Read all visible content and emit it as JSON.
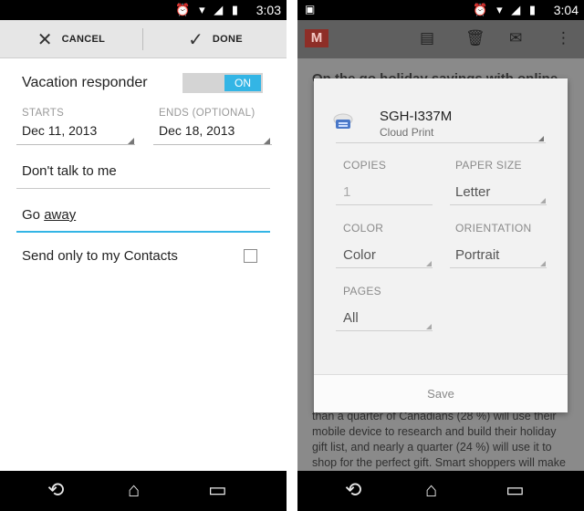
{
  "left": {
    "status": {
      "time": "3:03",
      "icons": "⏰ ▾ ◢ ▮"
    },
    "actionbar": {
      "cancel_label": "CANCEL",
      "done_label": "DONE",
      "cancel_glyph": "✕",
      "done_glyph": "✓"
    },
    "vacation": {
      "label": "Vacation responder",
      "toggle_value": "ON"
    },
    "starts": {
      "caption": "STARTS",
      "value": "Dec 11, 2013"
    },
    "ends": {
      "caption": "ENDS (OPTIONAL)",
      "value": "Dec 18, 2013"
    },
    "subject": "Don't talk to me",
    "message": {
      "prefix": "Go ",
      "underlined": "away"
    },
    "contacts_only": {
      "label": "Send only to my Contacts",
      "checked": false
    },
    "accent": "#33b5e5"
  },
  "right": {
    "status": {
      "time": "3:04",
      "icons": "⏰ ▾ ◢ ▮",
      "notification_icon": "▣"
    },
    "gmail": {
      "logo": "M"
    },
    "background_headline": "On the go holiday savings with online",
    "background_text": "than a quarter of Canadians (28 %) will use their mobile device to research and build their holiday gift list, and nearly a quarter (24 %) will use it to shop for the perfect gift. Smart shoppers will make",
    "print_dialog": {
      "printer_name": "SGH-I337M",
      "printer_sub": "Cloud Print",
      "copies": {
        "caption": "COPIES",
        "value": "1"
      },
      "paper_size": {
        "caption": "PAPER SIZE",
        "value": "Letter"
      },
      "color": {
        "caption": "COLOR",
        "value": "Color"
      },
      "orientation": {
        "caption": "ORIENTATION",
        "value": "Portrait"
      },
      "pages": {
        "caption": "PAGES",
        "value": "All"
      },
      "save_label": "Save"
    }
  },
  "navbar": {
    "back": "⟲",
    "home": "⌂",
    "recent": "▭"
  }
}
